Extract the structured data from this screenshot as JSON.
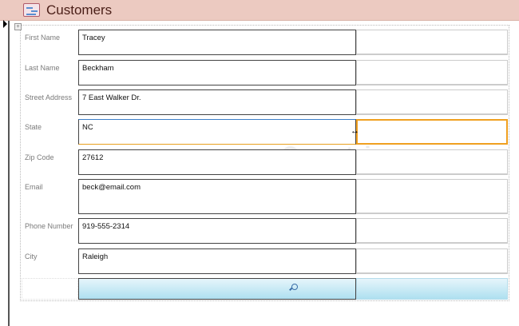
{
  "header": {
    "title": "Customers"
  },
  "fields": [
    {
      "label": "First Name",
      "value": "Tracey"
    },
    {
      "label": "Last Name",
      "value": "Beckham"
    },
    {
      "label": "Street Address",
      "value": "7 East Walker Dr."
    },
    {
      "label": "State",
      "value": "NC"
    },
    {
      "label": "Zip Code",
      "value": "27612"
    },
    {
      "label": "Email",
      "value": "beck@email.com"
    },
    {
      "label": "Phone Number",
      "value": "919-555-2314"
    },
    {
      "label": "City",
      "value": "Raleigh"
    }
  ],
  "watermark": "Quantrimang",
  "colors": {
    "header": "#eccac1",
    "selection": "#f0a020",
    "button": "#aee0f0"
  }
}
